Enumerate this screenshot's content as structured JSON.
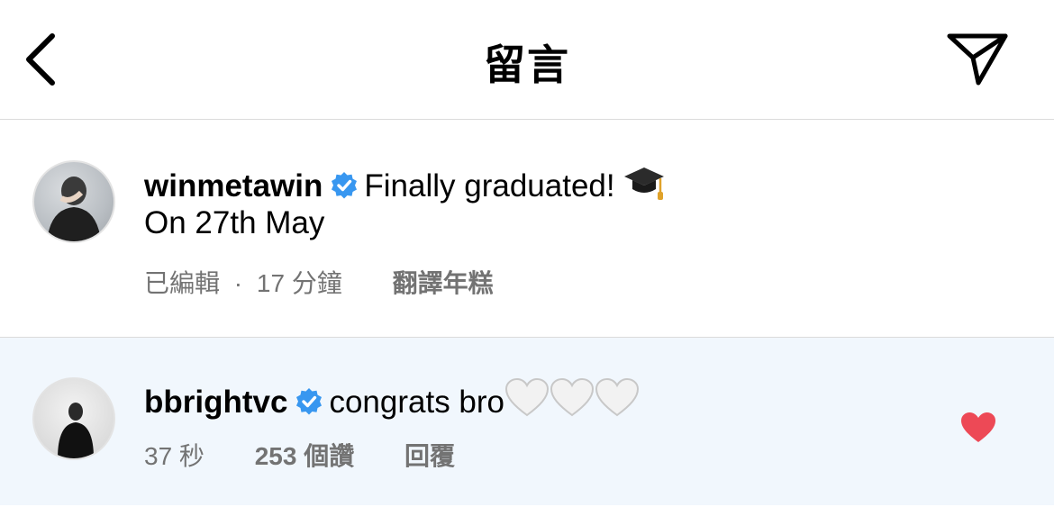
{
  "header": {
    "title": "留言",
    "back_icon": "chevron-left-icon",
    "send_icon": "paper-plane-icon"
  },
  "post": {
    "username": "winmetawin",
    "verified": true,
    "caption_line1": "Finally graduated!",
    "caption_emoji": "graduation-cap-icon",
    "caption_line2": "On 27th May",
    "edited": "已編輯",
    "separator": "·",
    "time": "17 分鐘",
    "translate": "翻譯年糕"
  },
  "reply": {
    "username": "bbrightvc",
    "verified": true,
    "text": "congrats bro",
    "emoji": [
      "white-heart-icon",
      "white-heart-icon",
      "white-heart-icon"
    ],
    "time": "37 秒",
    "likes": "253 個讚",
    "reply_label": "回覆",
    "liked": true,
    "like_color": "#ed4956"
  },
  "colors": {
    "verified": "#3897f0",
    "meta_text": "#737373",
    "reply_bg": "#f1f7fd",
    "divider": "#dbdbdb"
  }
}
